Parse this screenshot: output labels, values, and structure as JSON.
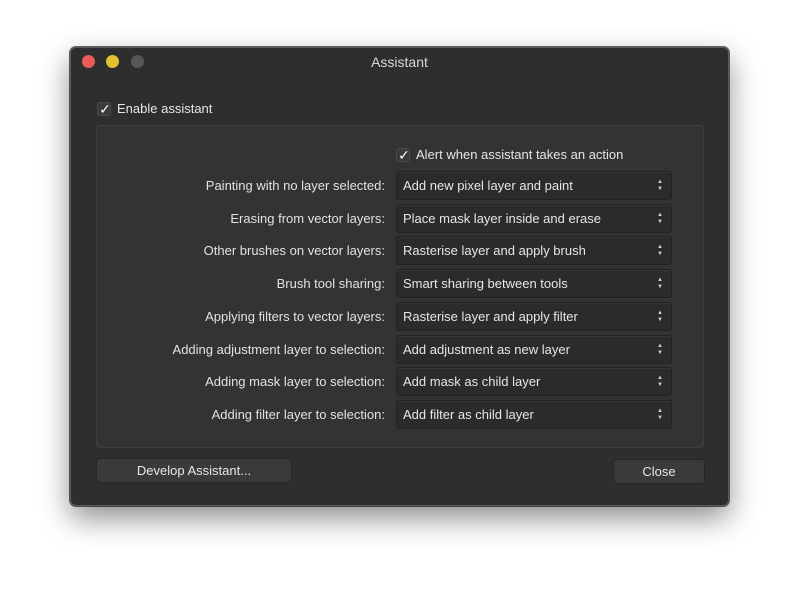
{
  "window": {
    "title": "Assistant",
    "traffic_lights": [
      "close",
      "minimize",
      "zoom"
    ]
  },
  "enable_assistant": {
    "label": "Enable assistant",
    "checked": true,
    "check_glyph": "✓"
  },
  "alert_checkbox": {
    "label": "Alert when assistant takes an action",
    "checked": true,
    "check_glyph": "✓"
  },
  "settings": [
    {
      "label": "Painting with no layer selected:",
      "value": "Add new pixel layer and paint"
    },
    {
      "label": "Erasing from vector layers:",
      "value": "Place mask layer inside and erase"
    },
    {
      "label": "Other brushes on vector layers:",
      "value": "Rasterise layer and apply brush"
    },
    {
      "label": "Brush tool sharing:",
      "value": "Smart sharing between tools"
    },
    {
      "label": "Applying filters to vector layers:",
      "value": "Rasterise layer and apply filter"
    },
    {
      "label": "Adding adjustment layer to selection:",
      "value": "Add adjustment as new layer"
    },
    {
      "label": "Adding mask layer to selection:",
      "value": "Add mask as child layer"
    },
    {
      "label": "Adding filter layer to selection:",
      "value": "Add filter as child layer"
    }
  ],
  "select_arrows": {
    "up": "▲",
    "down": "▼"
  },
  "buttons": {
    "develop": "Develop Assistant...",
    "close": "Close"
  }
}
